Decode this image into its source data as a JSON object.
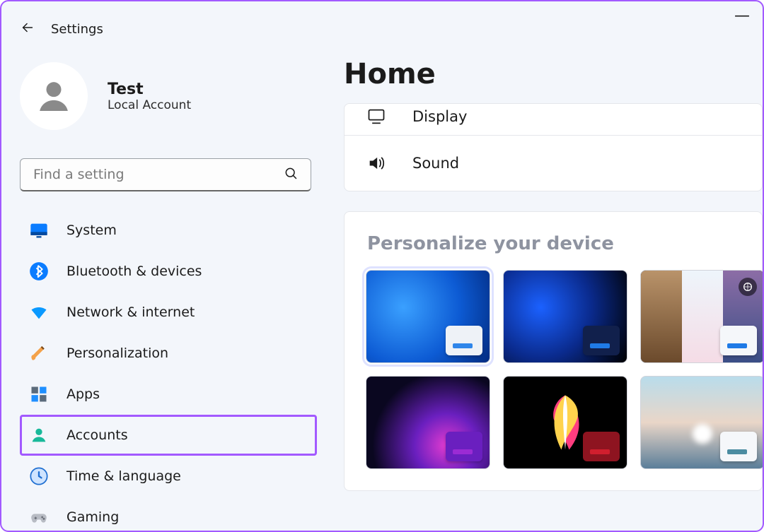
{
  "window": {
    "title": "Settings"
  },
  "user": {
    "name": "Test",
    "subtitle": "Local Account"
  },
  "search": {
    "placeholder": "Find a setting"
  },
  "sidebar": {
    "items": [
      {
        "id": "system",
        "label": "System"
      },
      {
        "id": "bluetooth",
        "label": "Bluetooth & devices"
      },
      {
        "id": "network",
        "label": "Network & internet"
      },
      {
        "id": "personalization",
        "label": "Personalization"
      },
      {
        "id": "apps",
        "label": "Apps"
      },
      {
        "id": "accounts",
        "label": "Accounts",
        "highlighted": true
      },
      {
        "id": "time",
        "label": "Time & language"
      },
      {
        "id": "gaming",
        "label": "Gaming"
      }
    ]
  },
  "main": {
    "title": "Home",
    "quick": [
      {
        "id": "display",
        "label": "Display",
        "icon": "monitor-icon"
      },
      {
        "id": "sound",
        "label": "Sound",
        "icon": "speaker-icon"
      }
    ],
    "personalize": {
      "heading": "Personalize your device",
      "themes": [
        {
          "id": "bloom-light",
          "accent": "#2f86ea",
          "swatch_bg": "#eef2f7",
          "active": true
        },
        {
          "id": "bloom-dark",
          "accent": "#1f7ae6",
          "swatch_bg": "#11204c"
        },
        {
          "id": "spotlight",
          "accent": "#1f7ae6",
          "swatch_bg": "#f5f7fa",
          "spotlight": true
        },
        {
          "id": "glow",
          "accent": "#9b2bd4",
          "swatch_bg": "#6a1fbf"
        },
        {
          "id": "flow",
          "accent": "#d01f2e",
          "swatch_bg": "#8e1420"
        },
        {
          "id": "sunrise",
          "accent": "#4b8ca1",
          "swatch_bg": "#f5f7fa"
        }
      ]
    }
  }
}
